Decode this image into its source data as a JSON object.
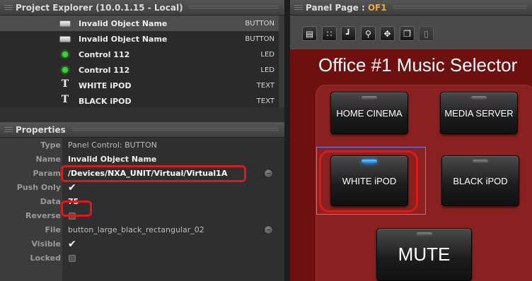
{
  "explorer": {
    "title": "Project Explorer (10.0.1.15 - Local)",
    "items": [
      {
        "icon": "button-icon",
        "name": "Invalid Object Name",
        "kind": "BUTTON",
        "selected": true
      },
      {
        "icon": "button-icon",
        "name": "Invalid Object Name",
        "kind": "BUTTON",
        "selected": false
      },
      {
        "icon": "led-icon",
        "name": "Control 112",
        "kind": "LED",
        "selected": false
      },
      {
        "icon": "led-icon",
        "name": "Control 112",
        "kind": "LED",
        "selected": false
      },
      {
        "icon": "text-icon",
        "name": "WHITE iPOD",
        "kind": "TEXT",
        "selected": false
      },
      {
        "icon": "text-icon",
        "name": "BLACK iPOD",
        "kind": "TEXT",
        "selected": false
      }
    ]
  },
  "properties": {
    "title": "Properties",
    "rows": {
      "type": {
        "label": "Type",
        "value": "Panel Control: BUTTON"
      },
      "name": {
        "label": "Name",
        "value": "Invalid Object Name"
      },
      "param": {
        "label": "Param",
        "value": "/Devices/NXA_UNIT/Virtual/Virtual1A"
      },
      "push_only": {
        "label": "Push Only",
        "checked": true
      },
      "data": {
        "label": "Data",
        "value": "75"
      },
      "reverse": {
        "label": "Reverse",
        "checked": false
      },
      "file": {
        "label": "File",
        "value": "button_large_black_rectangular_02"
      },
      "visible": {
        "label": "Visible",
        "checked": true
      },
      "locked": {
        "label": "Locked",
        "checked": false
      }
    },
    "checkmark": "✔"
  },
  "panel": {
    "title_prefix": "Panel Page :",
    "page_name": "OF1",
    "toolbar_icons": [
      "layout-icon",
      "grid-icon",
      "align-icon",
      "zoom-icon",
      "move-icon",
      "copy-icon",
      "paste-icon"
    ],
    "canvas_title": "Office #1 Music Selector",
    "buttons": {
      "home_cinema": "HOME CINEMA",
      "media_server": "MEDIA SERVER",
      "white_ipod": "WHITE iPOD",
      "black_ipod": "BLACK iPOD",
      "mute": "MUTE"
    }
  },
  "colors": {
    "accent": "#f0a64a",
    "highlight": "#d81b1b",
    "led_green": "#35d62e",
    "led_blue": "#39a0ff",
    "canvas_bg": "#6e1010"
  }
}
